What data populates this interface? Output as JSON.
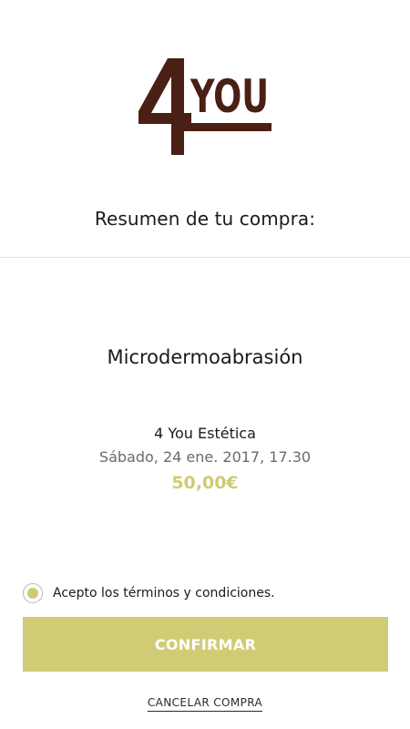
{
  "brand": {
    "logo_digit": "4",
    "logo_word": "YOU",
    "logo_color": "#4a2014"
  },
  "summary": {
    "title": "Resumen de tu compra:"
  },
  "booking": {
    "service": "Microdermoabrasión",
    "salon": "4 You Estética",
    "datetime": "Sábado, 24 ene. 2017, 17.30",
    "price": "50,00€"
  },
  "terms": {
    "label": "Acepto los términos y condiciones.",
    "selected": true
  },
  "actions": {
    "confirm_label": "CONFIRMAR",
    "cancel_label": "CANCELAR COMPRA"
  },
  "colors": {
    "accent": "#d0cc75",
    "price": "#cfcb72",
    "secondary_text": "#6a6a6a"
  }
}
